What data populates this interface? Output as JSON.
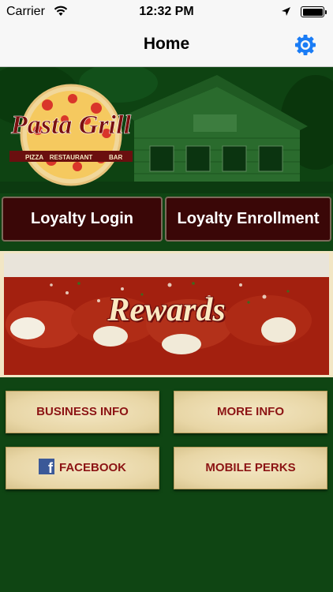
{
  "status_bar": {
    "carrier": "Carrier",
    "time": "12:32 PM"
  },
  "nav": {
    "title": "Home",
    "settings_icon": "gear-icon"
  },
  "hero": {
    "logo": {
      "name": "Pasta Grill",
      "tags": [
        "PIZZA",
        "RESTAURANT",
        "BAR"
      ]
    }
  },
  "loyalty": {
    "login_label": "Loyalty Login",
    "enroll_label": "Loyalty Enrollment"
  },
  "rewards": {
    "label": "Rewards"
  },
  "menu": {
    "business_info": "BUSINESS INFO",
    "more_info": "MORE INFO",
    "facebook": "FACEBOOK",
    "mobile_perks": "MOBILE PERKS"
  },
  "colors": {
    "background_green": "#0f4513",
    "accent_blue": "#1a7cf5",
    "button_maroon": "#3a0707",
    "button_text_red": "#8c1414",
    "button_cream": "#f0e2bd"
  }
}
